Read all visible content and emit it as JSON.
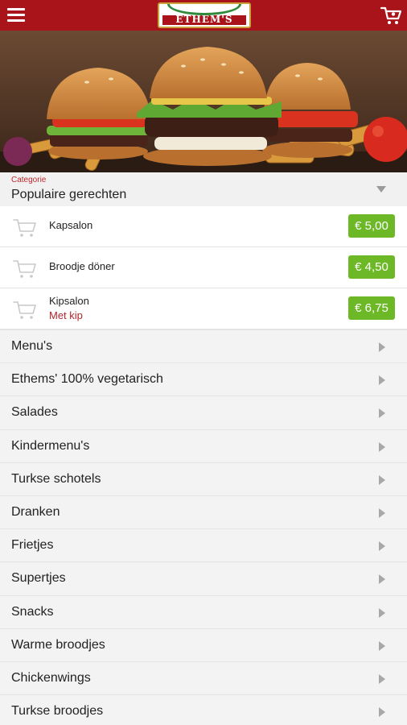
{
  "header": {
    "logo_text": "ETHEM'S",
    "icons": {
      "menu": "hamburger-icon",
      "cart": "shopping-cart-icon"
    },
    "color": "#a9141b"
  },
  "category": {
    "caption": "Categorie",
    "selected": "Populaire gerechten"
  },
  "popular_items": [
    {
      "name": "Kapsalon",
      "subtitle": "",
      "price": "€ 5,00"
    },
    {
      "name": "Broodje döner",
      "subtitle": "",
      "price": "€ 4,50"
    },
    {
      "name": "Kipsalon",
      "subtitle": "Met kip",
      "price": "€ 6,75"
    }
  ],
  "menu_items": [
    "Menu's",
    "Ethems' 100% vegetarisch",
    "Salades",
    "Kindermenu's",
    "Turkse schotels",
    "Dranken",
    "Frietjes",
    "Supertjes",
    "Snacks",
    "Warme broodjes",
    "Chickenwings",
    "Turkse broodjes"
  ],
  "colors": {
    "accent": "#a9141b",
    "price_badge": "#6cb826",
    "subtitle": "#b3262c"
  }
}
